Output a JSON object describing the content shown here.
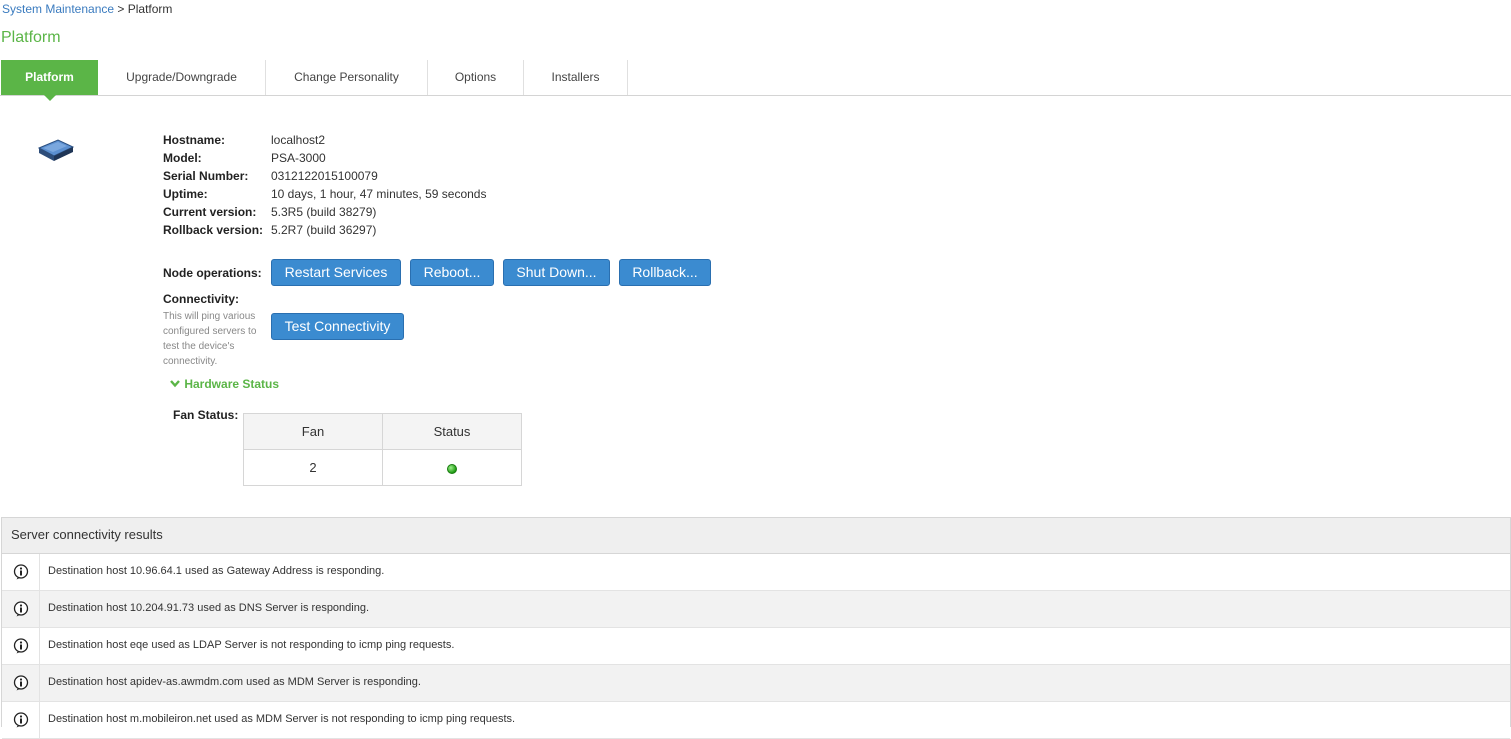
{
  "breadcrumb": {
    "parent": "System Maintenance",
    "separator": " > ",
    "current": "Platform"
  },
  "page": {
    "title": "Platform"
  },
  "tabs": [
    {
      "label": "Platform",
      "active": true
    },
    {
      "label": "Upgrade/Downgrade",
      "active": false
    },
    {
      "label": "Change Personality",
      "active": false
    },
    {
      "label": "Options",
      "active": false
    },
    {
      "label": "Installers",
      "active": false
    }
  ],
  "device": {
    "icon": "server-appliance-icon",
    "hostname_label": "Hostname:",
    "hostname": "localhost2",
    "model_label": "Model:",
    "model": "PSA-3000",
    "serial_label": "Serial Number:",
    "serial": "0312122015100079",
    "uptime_label": "Uptime:",
    "uptime": "10 days, 1 hour, 47 minutes, 59 seconds",
    "current_version_label": "Current version:",
    "current_version": "5.3R5 (build 38279)",
    "rollback_version_label": "Rollback version:",
    "rollback_version": "5.2R7 (build 36297)"
  },
  "node_operations": {
    "label": "Node operations:",
    "restart_label": "Restart Services",
    "reboot_label": "Reboot...",
    "shutdown_label": "Shut Down...",
    "rollback_label": "Rollback..."
  },
  "connectivity": {
    "label": "Connectivity:",
    "help": "This will ping various configured servers to test the device's connectivity.",
    "button_label": "Test Connectivity"
  },
  "hardware_status": {
    "toggle_label": "Hardware Status",
    "fan_label": "Fan Status:",
    "columns": [
      "Fan",
      "Status"
    ],
    "rows": [
      {
        "fan": "2",
        "status": "ok"
      }
    ],
    "status_color": "#2fa824"
  },
  "results": {
    "title": "Server connectivity results",
    "rows": [
      "Destination host 10.96.64.1 used as Gateway Address is responding.",
      "Destination host 10.204.91.73 used as DNS Server is responding.",
      "Destination host eqe used as LDAP Server is not responding to icmp ping requests.",
      "Destination host apidev-as.awmdm.com used as MDM Server is responding.",
      "Destination host m.mobileiron.net used as MDM Server is not responding to icmp ping requests."
    ]
  },
  "colors": {
    "accent": "#5bb547",
    "button": "#3b8bd0",
    "link": "#3a7bbf"
  }
}
